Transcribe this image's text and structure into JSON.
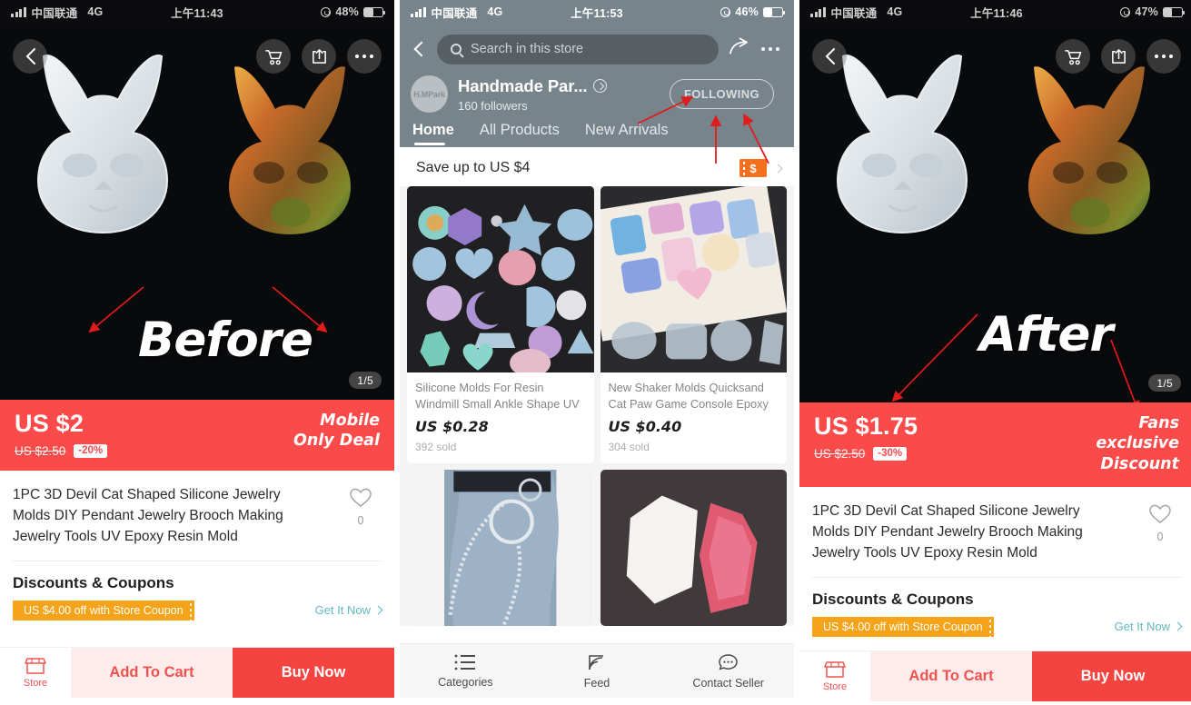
{
  "panels": {
    "left": {
      "status": {
        "carrier": "中国联通",
        "network": "4G",
        "time": "上午11:43",
        "battery": "48%"
      },
      "hero": {
        "word": "Before",
        "counter": "1/5",
        "icons": {
          "back": "back-chevron-icon",
          "cart": "cart-icon",
          "share": "share-icon",
          "more": "more-dots-icon"
        }
      },
      "price": {
        "current": "US $2",
        "original": "US $2.50",
        "discount": "-20%",
        "tag_line1": "Mobile",
        "tag_line2": "Only Deal",
        "bar_color": "#fb4a4a"
      },
      "product": {
        "title": "1PC 3D Devil Cat Shaped Silicone Jewelry Molds DIY Pendant Jewelry Brooch Making Jewelry Tools UV Epoxy Resin Mold",
        "wish_count": "0"
      },
      "discounts": {
        "heading": "Discounts & Coupons",
        "coupon": "US $4.00 off with Store Coupon",
        "get_it_now": "Get It Now"
      },
      "actions": {
        "store": "Store",
        "add_to_cart": "Add To Cart",
        "buy_now": "Buy Now"
      }
    },
    "middle": {
      "status": {
        "carrier": "中国联通",
        "network": "4G",
        "time": "上午11:53",
        "battery": "46%"
      },
      "search": {
        "placeholder": "Search in this store"
      },
      "store": {
        "avatar_text": "H.MPark",
        "name": "Handmade Par...",
        "followers": "160  followers",
        "follow_button": "FOLLOWING"
      },
      "tabs": [
        {
          "label": "Home",
          "active": true
        },
        {
          "label": "All Products",
          "active": false
        },
        {
          "label": "New Arrivals",
          "active": false
        }
      ],
      "promo": {
        "text": "Save up to US $4"
      },
      "products": [
        {
          "title": "Silicone Molds For Resin Windmill Small Ankle Shape UV ...",
          "price": "US $0.28",
          "sold": "392 sold"
        },
        {
          "title": "New Shaker Molds Quicksand Cat Paw Game Console Epoxy ...",
          "price": "US $0.40",
          "sold": "304 sold"
        }
      ],
      "tabbar": [
        {
          "label": "Categories",
          "icon": "list-icon"
        },
        {
          "label": "Feed",
          "icon": "feed-icon"
        },
        {
          "label": "Contact Seller",
          "icon": "chat-icon"
        }
      ]
    },
    "right": {
      "status": {
        "carrier": "中国联通",
        "network": "4G",
        "time": "上午11:46",
        "battery": "47%"
      },
      "hero": {
        "word": "After",
        "counter": "1/5",
        "icons": {
          "back": "back-chevron-icon",
          "cart": "cart-icon",
          "share": "share-icon",
          "more": "more-dots-icon"
        }
      },
      "price": {
        "current": "US $1.75",
        "original": "US $2.50",
        "discount": "-30%",
        "tag_line1": "Fans",
        "tag_line2": "exclusive",
        "tag_line3": "Discount",
        "bar_color": "#fb4a4a"
      },
      "product": {
        "title": "1PC 3D Devil Cat Shaped Silicone Jewelry Molds DIY Pendant Jewelry Brooch Making Jewelry Tools UV Epoxy Resin Mold",
        "wish_count": "0"
      },
      "discounts": {
        "heading": "Discounts & Coupons",
        "coupon": "US $4.00 off with Store Coupon",
        "get_it_now": "Get It Now"
      },
      "actions": {
        "store": "Store",
        "add_to_cart": "Add To Cart",
        "buy_now": "Buy Now"
      }
    }
  },
  "colors": {
    "red": "#fb4a4a",
    "buy_red": "#f5443f",
    "cart_pink": "#fdeceb",
    "coupon_orange": "#f5a318",
    "teal": "#5fb8bf",
    "store_gray": "#78848c",
    "annotation_red": "#e01b1b"
  }
}
